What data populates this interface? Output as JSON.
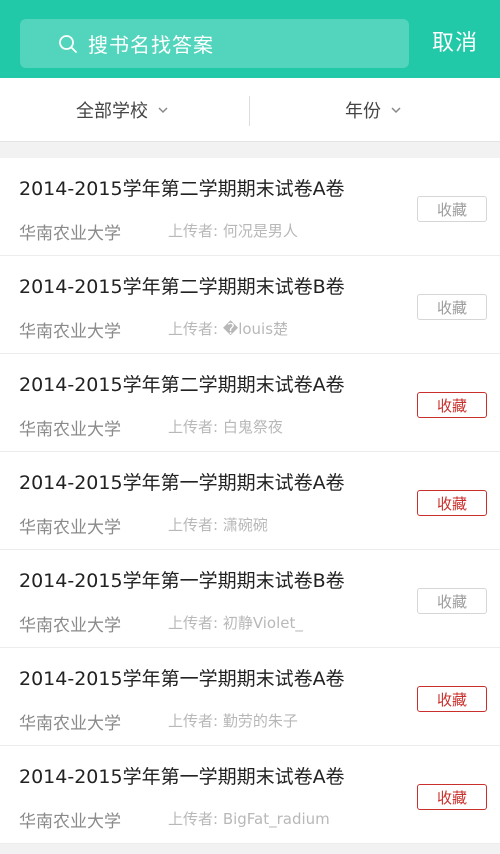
{
  "header": {
    "search_placeholder": "搜书名找答案",
    "cancel_label": "取消"
  },
  "filters": {
    "school_label": "全部学校",
    "year_label": "年份"
  },
  "items": [
    {
      "title": "2014-2015学年第二学期期末试卷A卷",
      "school": "华南农业大学",
      "uploader": "上传者: 何况是男人",
      "fav_label": "收藏",
      "favorited": false
    },
    {
      "title": "2014-2015学年第二学期期末试卷B卷",
      "school": "华南农业大学",
      "uploader": "上传者: �louis楚",
      "fav_label": "收藏",
      "favorited": false
    },
    {
      "title": "2014-2015学年第二学期期末试卷A卷",
      "school": "华南农业大学",
      "uploader": "上传者: 白鬼祭夜",
      "fav_label": "收藏",
      "favorited": true
    },
    {
      "title": "2014-2015学年第一学期期末试卷A卷",
      "school": "华南农业大学",
      "uploader": "上传者: 潇碗碗",
      "fav_label": "收藏",
      "favorited": true
    },
    {
      "title": "2014-2015学年第一学期期末试卷B卷",
      "school": "华南农业大学",
      "uploader": "上传者: 初静Violet_",
      "fav_label": "收藏",
      "favorited": false
    },
    {
      "title": "2014-2015学年第一学期期末试卷A卷",
      "school": "华南农业大学",
      "uploader": "上传者: 勤劳的朱子",
      "fav_label": "收藏",
      "favorited": true
    },
    {
      "title": "2014-2015学年第一学期期末试卷A卷",
      "school": "华南农业大学",
      "uploader": "上传者: BigFat_radium",
      "fav_label": "收藏",
      "favorited": true
    }
  ],
  "colors": {
    "accent": "#22c9a9",
    "favorite_active": "#c9302c",
    "favorite_inactive": "#9c9c9c"
  },
  "icons": {
    "search": "search-icon",
    "chevron": "chevron-down-icon"
  }
}
